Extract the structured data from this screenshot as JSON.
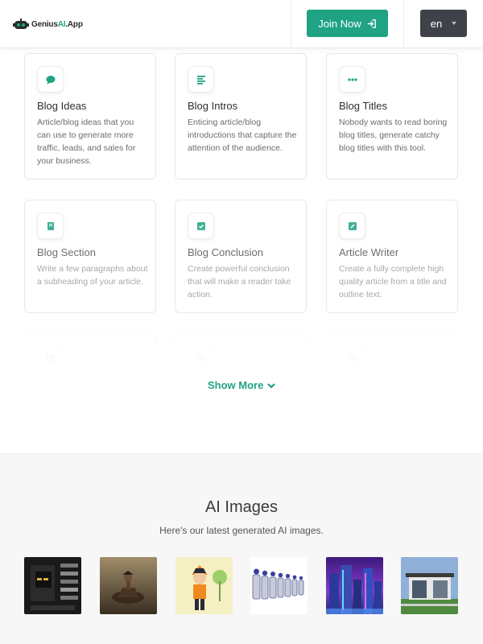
{
  "header": {
    "logo_prefix": "Genius",
    "logo_accent": "AI",
    "logo_suffix": ".App",
    "join_label": "Join Now",
    "lang_label": "en"
  },
  "cards": [
    {
      "title": "Blog Ideas",
      "desc": "Article/blog ideas that you can use to generate more traffic, leads, and sales for your business.",
      "icon": "chat-bubble-icon"
    },
    {
      "title": "Blog Intros",
      "desc": "Enticing article/blog introductions that capture the attention of the audience.",
      "icon": "align-left-icon"
    },
    {
      "title": "Blog Titles",
      "desc": "Nobody wants to read boring blog titles, generate catchy blog titles with this tool.",
      "icon": "ellipsis-icon"
    },
    {
      "title": "Blog Section",
      "desc": "Write a few paragraphs about a subheading of your article.",
      "icon": "book-icon"
    },
    {
      "title": "Blog Conclusion",
      "desc": "Create powerful conclusion that will make a reader take action.",
      "icon": "check-square-icon"
    },
    {
      "title": "Article Writer",
      "desc": "Create a fully complete high quality article from a title and outline text.",
      "icon": "edit-square-icon"
    }
  ],
  "show_more_label": "Show More",
  "images_section": {
    "title": "AI Images",
    "subtitle": "Here's our latest generated AI images."
  },
  "colors": {
    "accent": "#1fa383",
    "lang_bg": "#3f4349",
    "section_bg": "#f7f7f7"
  }
}
